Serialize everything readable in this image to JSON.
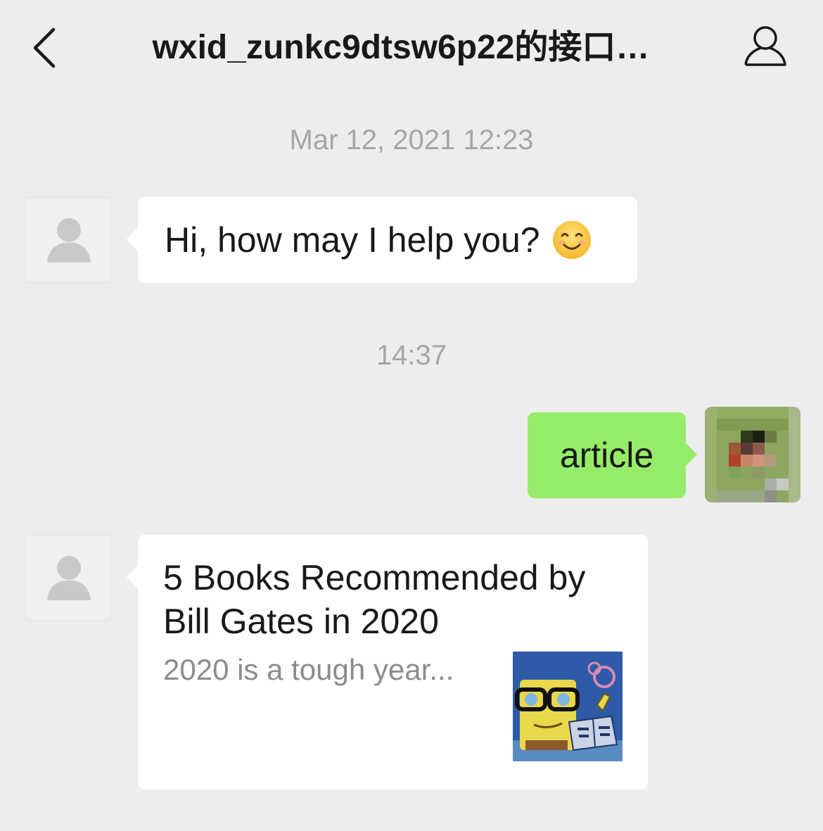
{
  "header": {
    "title": "wxid_zunkc9dtsw6p22的接口…",
    "back_icon": "chevron-left-icon",
    "profile_icon": "person-icon"
  },
  "chat": {
    "timestamps": [
      "Mar 12, 2021 12:23",
      "14:37"
    ],
    "messages": [
      {
        "side": "left",
        "type": "text",
        "text": "Hi, how may I help you?",
        "emoji": "smiling-face-icon"
      },
      {
        "side": "right",
        "type": "text",
        "text": "article"
      },
      {
        "side": "left",
        "type": "article",
        "title": "5 Books Recommended by Bill Gates in 2020",
        "description": "2020 is a tough year..."
      }
    ]
  },
  "colors": {
    "background": "#EDEDED",
    "incoming_bubble": "#FFFFFF",
    "outgoing_bubble": "#95EC69",
    "timestamp": "#A6A6A6",
    "description": "#8C8C8C"
  }
}
